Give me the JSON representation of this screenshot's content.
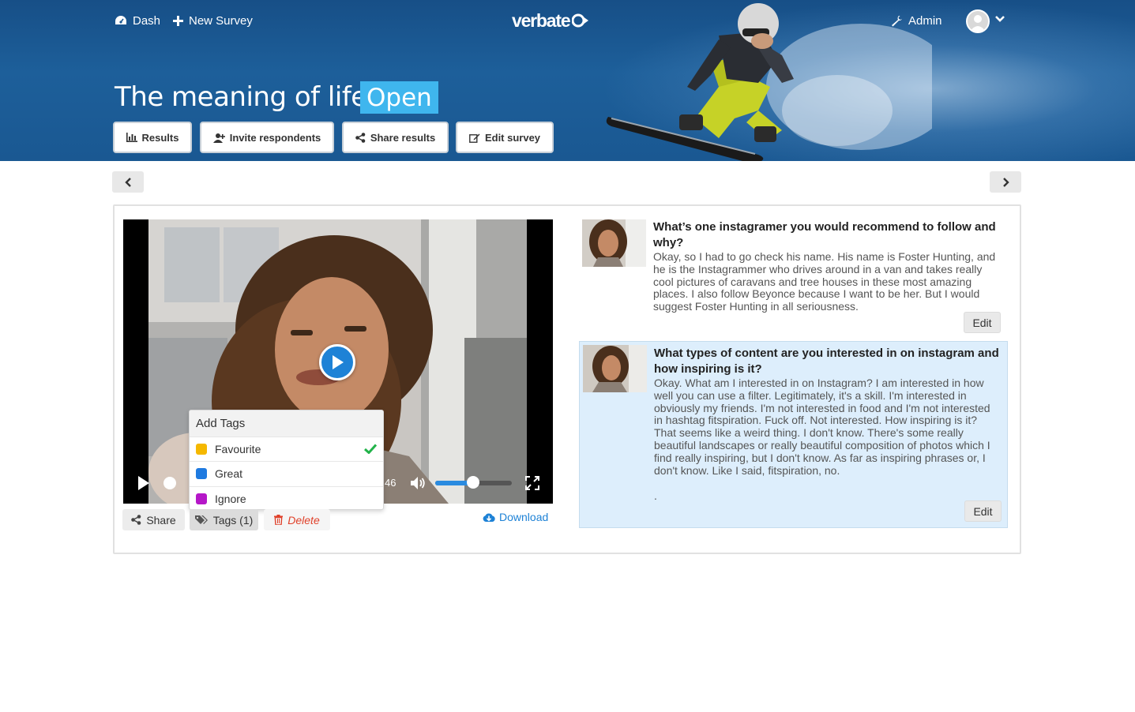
{
  "nav": {
    "dash_label": "Dash",
    "new_survey_label": "New Survey",
    "logo_text": "verbate",
    "admin_label": "Admin"
  },
  "survey": {
    "title": "The meaning of life",
    "status": "Open",
    "buttons": {
      "results": "Results",
      "invite": "Invite respondents",
      "share_results": "Share results",
      "edit_survey": "Edit survey"
    }
  },
  "player": {
    "time_fragment": "46",
    "volume_level": 0.5,
    "seek_position": 0.0
  },
  "tags_menu": {
    "title": "Add Tags",
    "items": [
      {
        "label": "Favourite",
        "color": "#f5b800",
        "checked": true
      },
      {
        "label": "Great",
        "color": "#1f7ae0",
        "checked": false
      },
      {
        "label": "Ignore",
        "color": "#b517c8",
        "checked": false
      }
    ]
  },
  "actions": {
    "share": "Share",
    "tags": "Tags (1)",
    "delete": "Delete",
    "download": "Download"
  },
  "responses": [
    {
      "question": "What’s one instagramer you would recommend to follow and why?",
      "answer": "Okay, so I had to go check his name. His name is Foster Hunting, and he is the Instagrammer who drives around in a van and takes really cool pictures of caravans and tree houses in these most amazing places. I also follow Beyonce because I want to be her. But I would suggest Foster Hunting in all seriousness.",
      "edit_label": "Edit"
    },
    {
      "question": "What types of content are you interested in on instagram and how inspiring is it?",
      "answer": "Okay. What am I interested in on Instagram? I am interested in how well you can use a filter. Legitimately, it's a skill. I'm interested in obviously my friends. I'm not interested in food and I'm not interested in hashtag fitspiration. Fuck off. Not interested. How inspiring is it? That seems like a weird thing. I don't know. There's some really beautiful landscapes or really beautiful composition of photos which I find really inspiring, but I don't know. As far as inspiring phrases or, I don't know. Like I said, fitspiration, no.",
      "trailing": ".",
      "edit_label": "Edit"
    }
  ],
  "colors": {
    "header_blue": "#1a5892",
    "accent_blue": "#1e82d6",
    "badge_blue": "#3fb6ee",
    "active_row": "#ddeefc",
    "delete_red": "#e0412a"
  }
}
